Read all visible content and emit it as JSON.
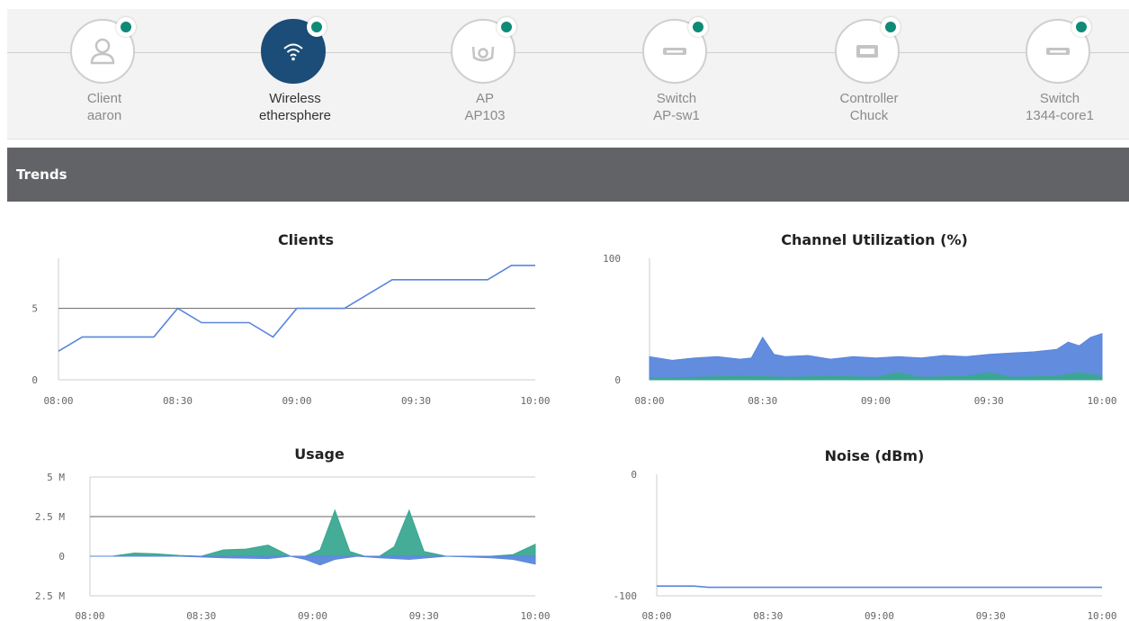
{
  "topology": {
    "nodes": [
      {
        "type": "Client",
        "name": "aaron",
        "icon": "client-icon",
        "active": false,
        "status": "online"
      },
      {
        "type": "Wireless",
        "name": "ethersphere",
        "icon": "wifi-icon",
        "active": true,
        "status": "online"
      },
      {
        "type": "AP",
        "name": "AP103",
        "icon": "access-point-icon",
        "active": false,
        "status": "online"
      },
      {
        "type": "Switch",
        "name": "AP-sw1",
        "icon": "switch-icon",
        "active": false,
        "status": "online"
      },
      {
        "type": "Controller",
        "name": "Chuck",
        "icon": "controller-icon",
        "active": false,
        "status": "online"
      },
      {
        "type": "Switch",
        "name": "1344-core1",
        "icon": "switch-icon",
        "active": false,
        "status": "online"
      }
    ]
  },
  "trends": {
    "title": "Trends"
  },
  "colors": {
    "accent": "#1b4d78",
    "status_online": "#0e8a76",
    "series_blue": "#5a86dc",
    "series_teal": "#3aa891",
    "header_bar": "#616366"
  },
  "chart_data": [
    {
      "type": "line",
      "title": "Clients",
      "x_ticks": [
        "08:00",
        "08:30",
        "09:00",
        "09:30",
        "10:00"
      ],
      "y_ticks": [
        "0",
        "5"
      ],
      "ylim": [
        0,
        8.5
      ],
      "xlim": [
        0,
        120
      ],
      "grid": true,
      "series": [
        {
          "color": "#5a86dc",
          "x": [
            0,
            6,
            12,
            18,
            24,
            30,
            36,
            42,
            48,
            54,
            60,
            66,
            72,
            78,
            84,
            90,
            96,
            102,
            108,
            114,
            120
          ],
          "values": [
            2,
            3,
            3,
            3,
            3,
            5,
            4,
            4,
            4,
            3,
            5,
            5,
            5,
            6,
            7,
            7,
            7,
            7,
            7,
            8,
            8
          ]
        }
      ]
    },
    {
      "type": "area",
      "title": "Channel Utilization (%)",
      "x_ticks": [
        "08:00",
        "08:30",
        "09:00",
        "09:30",
        "10:00"
      ],
      "y_ticks": [
        "0",
        "100"
      ],
      "ylim": [
        0,
        100
      ],
      "xlim": [
        0,
        120
      ],
      "grid": true,
      "series": [
        {
          "color": "#5a86dc",
          "x": [
            0,
            6,
            12,
            18,
            24,
            27,
            30,
            33,
            36,
            42,
            48,
            54,
            60,
            66,
            72,
            78,
            84,
            90,
            96,
            102,
            108,
            111,
            114,
            117,
            120
          ],
          "values": [
            19,
            16,
            18,
            19,
            17,
            18,
            35,
            21,
            19,
            20,
            17,
            19,
            18,
            19,
            18,
            20,
            19,
            21,
            22,
            23,
            25,
            31,
            28,
            35,
            38
          ]
        },
        {
          "color": "#3aa891",
          "x": [
            0,
            12,
            24,
            36,
            48,
            60,
            66,
            72,
            84,
            90,
            96,
            108,
            114,
            120
          ],
          "values": [
            1,
            2,
            3,
            2,
            3,
            2,
            6,
            2,
            3,
            6,
            2,
            3,
            6,
            3
          ]
        }
      ]
    },
    {
      "type": "area",
      "title": "Usage",
      "x_ticks": [
        "08:00",
        "08:30",
        "09:00",
        "09:30",
        "10:00"
      ],
      "y_ticks": [
        "5 M",
        "2.5 M",
        "0",
        "2.5 M"
      ],
      "ylim": [
        -2.5,
        5
      ],
      "xlim": [
        0,
        120
      ],
      "grid": true,
      "series": [
        {
          "color": "#3aa891",
          "x": [
            0,
            6,
            12,
            18,
            24,
            30,
            36,
            42,
            48,
            54,
            58,
            62,
            66,
            70,
            74,
            78,
            82,
            86,
            90,
            96,
            102,
            108,
            114,
            120
          ],
          "values": [
            0,
            0,
            0.2,
            0.15,
            0.05,
            0,
            0.4,
            0.45,
            0.7,
            0,
            0,
            0.4,
            2.9,
            0.3,
            0,
            0,
            0.6,
            2.9,
            0.3,
            0,
            0,
            0,
            0.1,
            0.75
          ]
        },
        {
          "color": "#5a86dc",
          "x": [
            0,
            24,
            36,
            48,
            54,
            58,
            62,
            66,
            72,
            78,
            86,
            96,
            108,
            114,
            120
          ],
          "values": [
            0,
            0,
            -0.1,
            -0.15,
            0,
            -0.2,
            -0.55,
            -0.2,
            0,
            -0.1,
            -0.2,
            0,
            -0.1,
            -0.2,
            -0.5
          ]
        }
      ]
    },
    {
      "type": "line",
      "title": "Noise (dBm)",
      "x_ticks": [
        "08:00",
        "08:30",
        "09:00",
        "09:30",
        "10:00"
      ],
      "y_ticks": [
        "-100",
        "0"
      ],
      "ylim": [
        -100,
        0
      ],
      "xlim": [
        0,
        120
      ],
      "grid": true,
      "series": [
        {
          "color": "#5a86dc",
          "x": [
            0,
            10,
            14,
            120
          ],
          "values": [
            -92,
            -92,
            -93,
            -93
          ]
        }
      ]
    }
  ]
}
